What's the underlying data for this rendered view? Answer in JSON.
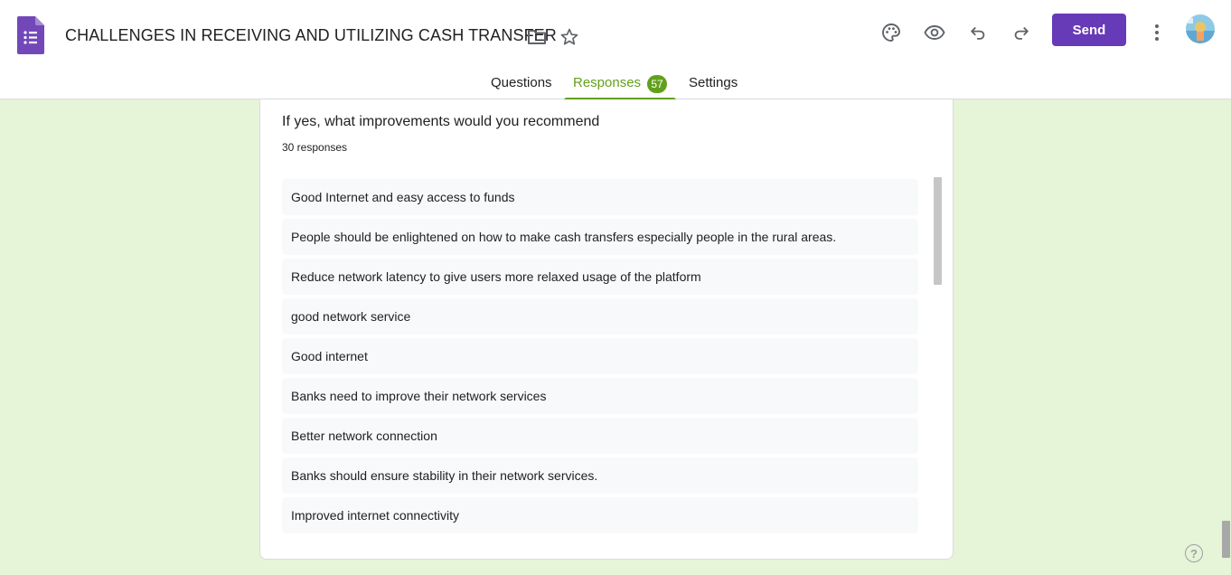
{
  "header": {
    "title": "CHALLENGES IN RECEIVING AND UTILIZING CASH TRANSFER",
    "send_label": "Send",
    "icons": [
      "forms-logo-icon",
      "folder-icon",
      "star-icon",
      "palette-icon",
      "preview-eye-icon",
      "undo-icon",
      "redo-icon",
      "more-vert-icon",
      "avatar"
    ]
  },
  "tabs": {
    "questions": "Questions",
    "responses": "Responses",
    "responses_count": "57",
    "settings": "Settings",
    "active": "Responses"
  },
  "question": {
    "title": "If yes, what improvements would you recommend",
    "count": "30 responses",
    "responses": [
      "Good Internet and easy access to funds",
      "People should be enlightened on how to make cash transfers especially people in the rural areas.",
      "Reduce network latency to give users more relaxed usage of the platform",
      "good network service",
      "Good internet",
      "Banks need to improve their network services",
      "Better network connection",
      "Banks should ensure stability in their network services.",
      "Improved internet connectivity"
    ]
  },
  "help": {
    "label": "?"
  },
  "colors": {
    "accent_purple": "#673ab7",
    "theme_green": "#62a01c",
    "background": "#e6f4d7"
  }
}
